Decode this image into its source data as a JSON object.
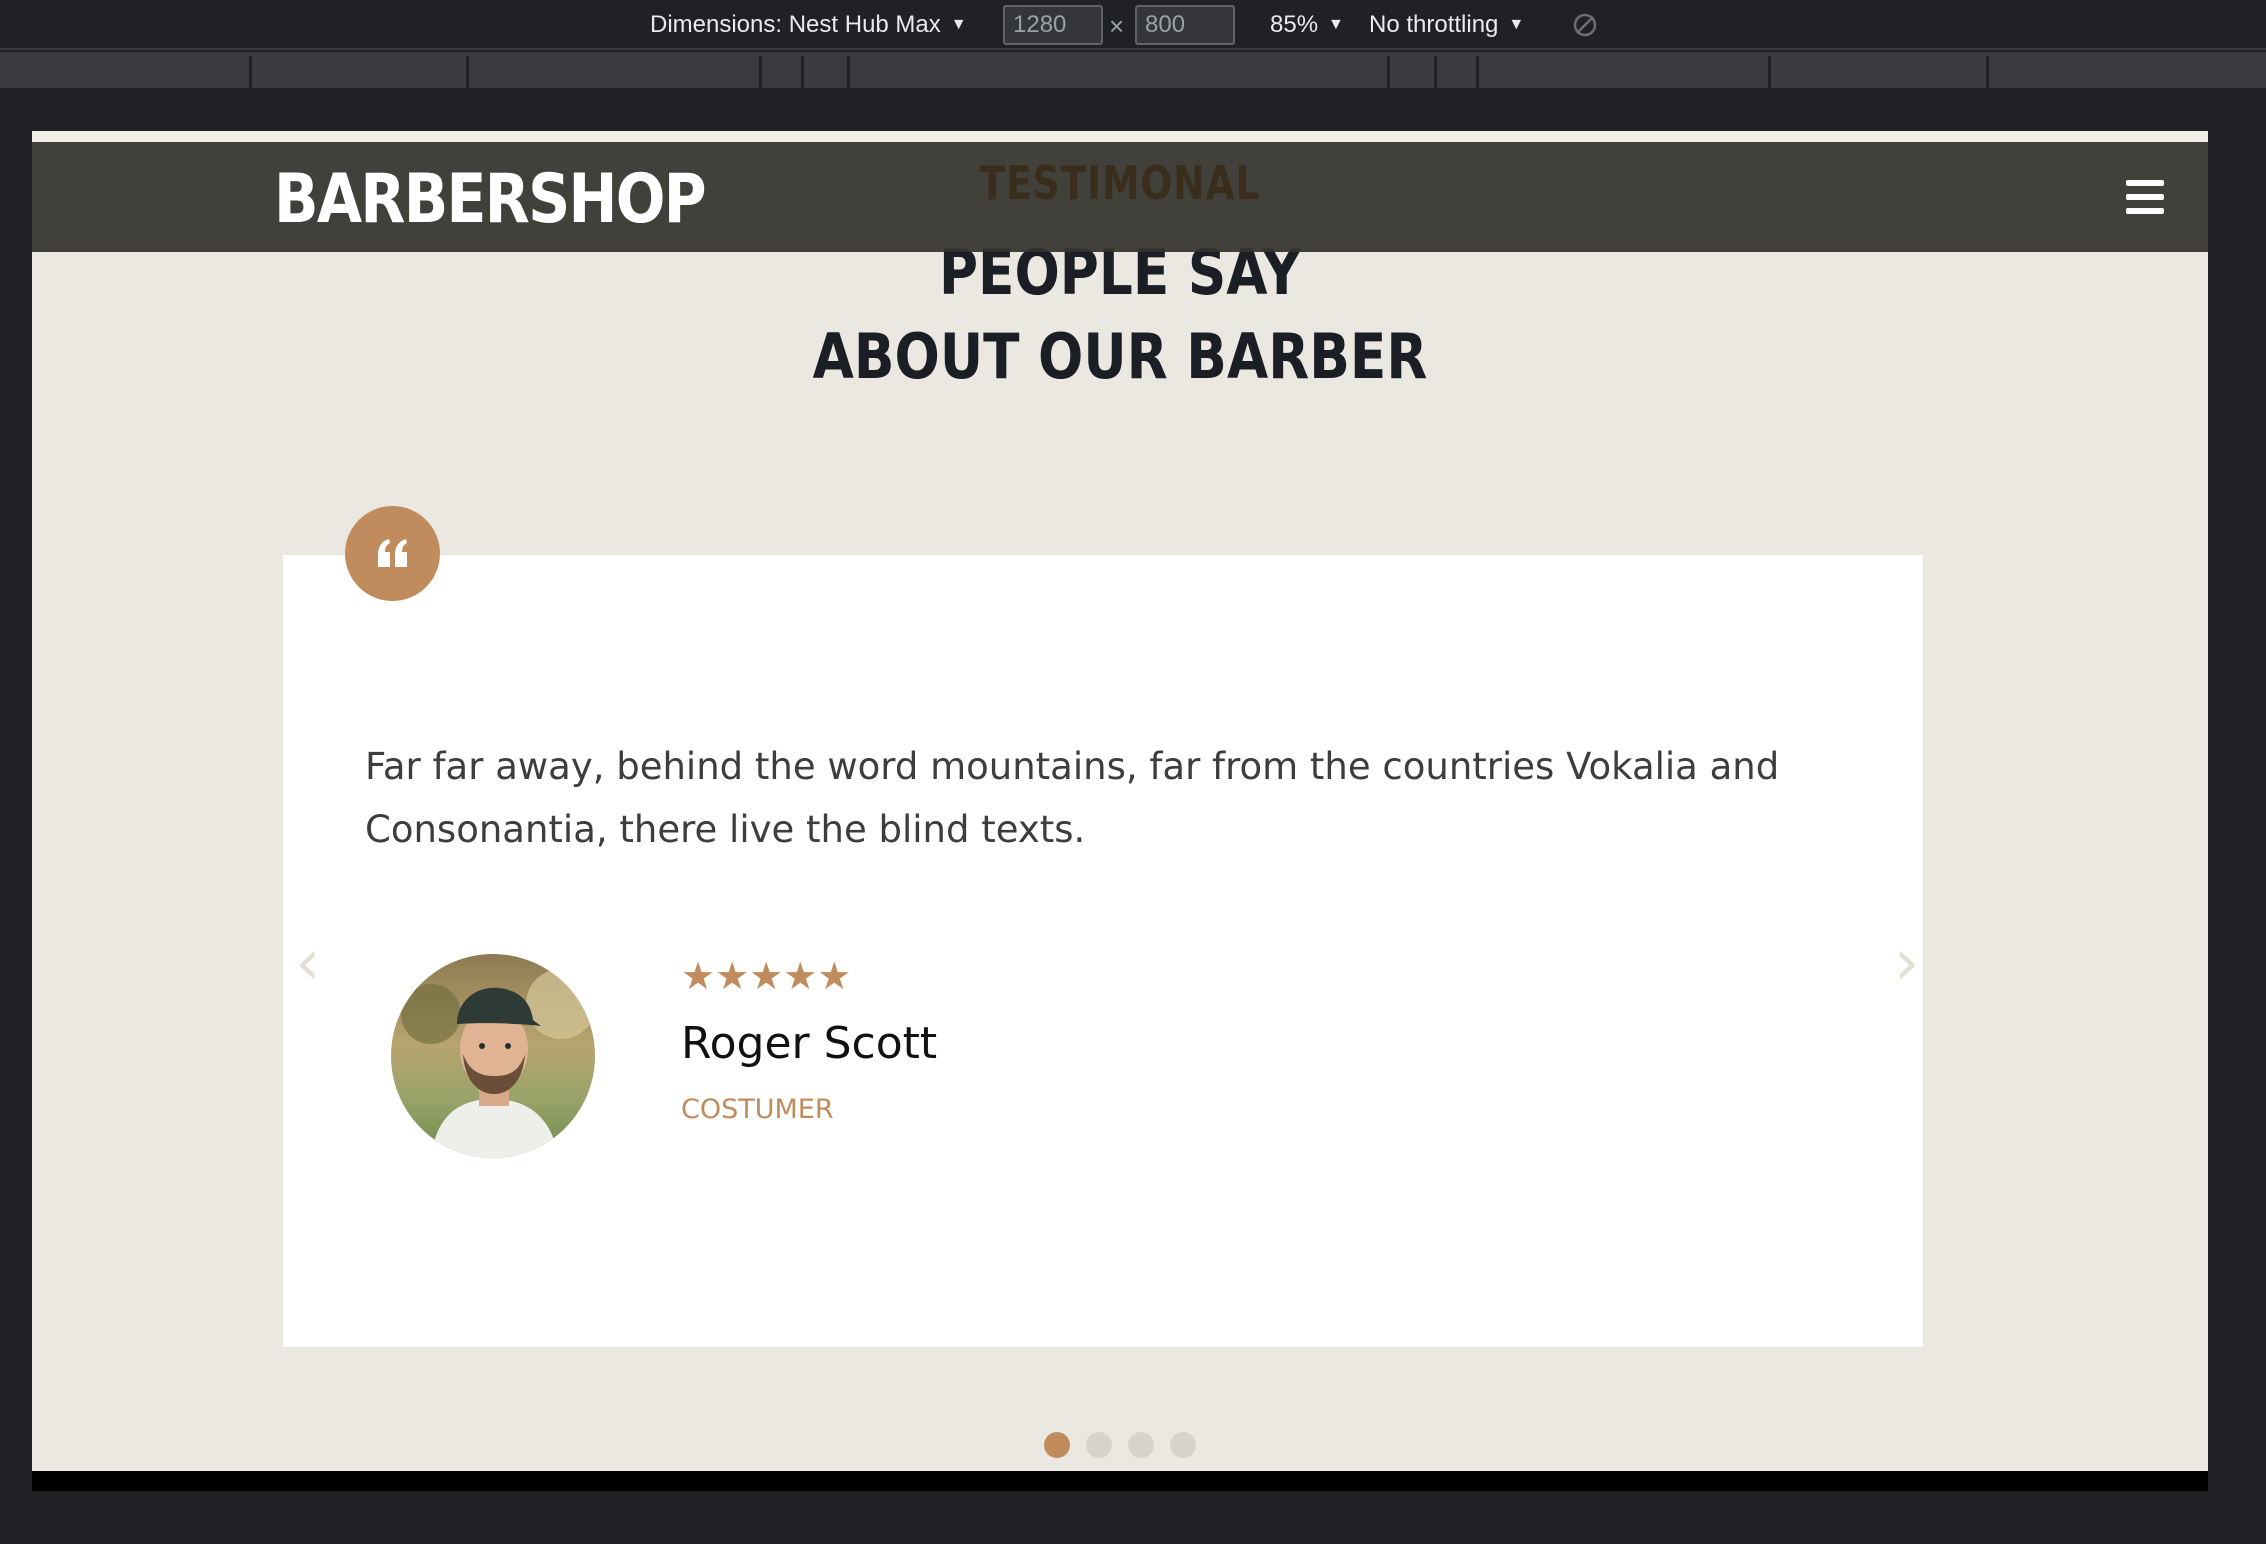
{
  "devtools": {
    "dimensions_label": "Dimensions: Nest Hub Max",
    "width_value": "1280",
    "height_value": "800",
    "times": "×",
    "zoom_label": "85%",
    "throttling_label": "No throttling",
    "icons": {
      "caret": "caret-down-icon",
      "rotate": "rotate-icon"
    }
  },
  "site": {
    "brand": "BARBERSHOP",
    "menu_icon": "hamburger-menu-icon"
  },
  "section": {
    "eyebrow": "TESTIMONAL",
    "title_line1": "PEOPLE SAY",
    "title_line2": "ABOUT OUR BARBER"
  },
  "testimonial": {
    "quote_icon": "quote-icon",
    "text": "Far far away, behind the word mountains, far from the countries Vokalia and Consonantia, there live the blind texts.",
    "rating": 5,
    "stars": "★★★★★",
    "name": "Roger Scott",
    "role": "COSTUMER"
  },
  "carousel": {
    "prev": "‹",
    "next": "›",
    "slides": 4,
    "active_index": 0
  },
  "colors": {
    "accent": "#c08c5d",
    "page_bg": "#ebe8e1",
    "navbar_bg": "#34332e",
    "heading": "#1b1e24"
  }
}
